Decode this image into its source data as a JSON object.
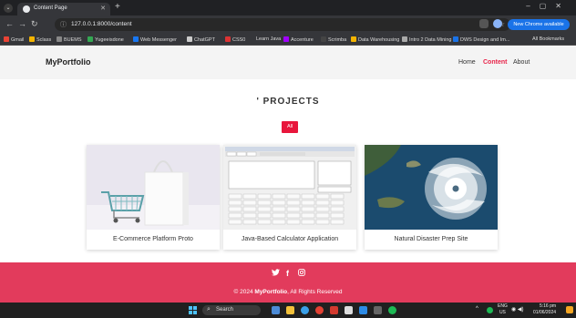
{
  "browser": {
    "tab_title": "Content Page",
    "url": "127.0.0.1:8000/content",
    "update_button": "New Chrome available",
    "bookmarks": [
      "Gmail",
      "Sclass",
      "BUEMS",
      "Yugeeisdone",
      "Web Messenger",
      "ChatGPT",
      "CSS0",
      "Learn Java",
      "Accenture",
      "Scrimba",
      "Data Warehousing",
      "Intro 2 Data Mining",
      "DWS Design and Im...",
      "All Bookmarks"
    ]
  },
  "site": {
    "brand": "MyPortfolio",
    "nav": [
      {
        "label": "Home"
      },
      {
        "label": "Content"
      },
      {
        "label": "About"
      }
    ]
  },
  "projects": {
    "title": "' PROJECTS",
    "filter_label": "All",
    "cards": [
      {
        "caption": "E-Commerce Platform Proto"
      },
      {
        "caption": "Java-Based Calculator Application"
      },
      {
        "caption": "Natural Disaster Prep Site"
      }
    ]
  },
  "footer": {
    "year_text": "© 2024",
    "brand": "MyPortfolio",
    "rights": ", All Rights Reserved"
  },
  "taskbar": {
    "search_label": "Search",
    "lang_top": "ENG",
    "lang_bottom": "US",
    "time": "5:16 pm",
    "date": "01/06/2024"
  },
  "colors": {
    "accent": "#e8163c",
    "footer": "#e23b5c"
  }
}
